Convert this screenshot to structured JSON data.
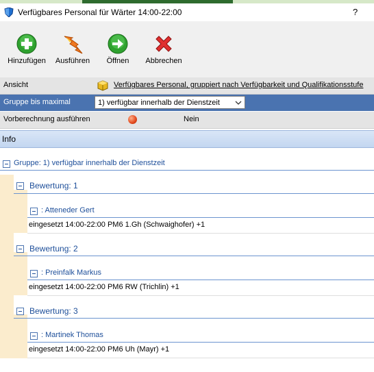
{
  "window": {
    "title": "Verfügbares Personal für Wärter 14:00-22:00",
    "help": "?"
  },
  "toolbar": {
    "add_label": "Hinzufügen",
    "run_label": "Ausführen",
    "open_label": "Öffnen",
    "cancel_label": "Abbrechen"
  },
  "props": {
    "ansicht_label": "Ansicht",
    "ansicht_value": "Verfügbares Personal, gruppiert nach Verfügbarkeit und Qualifikationsstufe",
    "gruppe_label": "Gruppe bis maximal",
    "gruppe_value": "1) verfügbar innerhalb der Dienstzeit",
    "vorb_label": "Vorberechnung ausführen",
    "vorb_value": "Nein"
  },
  "info": {
    "title": "Info"
  },
  "tree": {
    "group_label": "Gruppe: 1) verfügbar innerhalb der Dienstzeit",
    "ratings": [
      {
        "label": "Bewertung:  1",
        "person": ": Atteneder Gert",
        "entry": "eingesetzt 14:00-22:00 PM6 1.Gh (Schwaighofer) +1"
      },
      {
        "label": "Bewertung:  2",
        "person": ": Preinfalk Markus",
        "entry": "eingesetzt 14:00-22:00 PM6 RW (Trichlin) +1"
      },
      {
        "label": "Bewertung:  3",
        "person": ": Martinek Thomas",
        "entry": "eingesetzt 14:00-22:00 PM6 Uh (Mayr) +1"
      }
    ]
  },
  "colors": {
    "accent": "#4a73b0",
    "link": "#1e4f9a",
    "sidebar": "#fbeccd"
  }
}
